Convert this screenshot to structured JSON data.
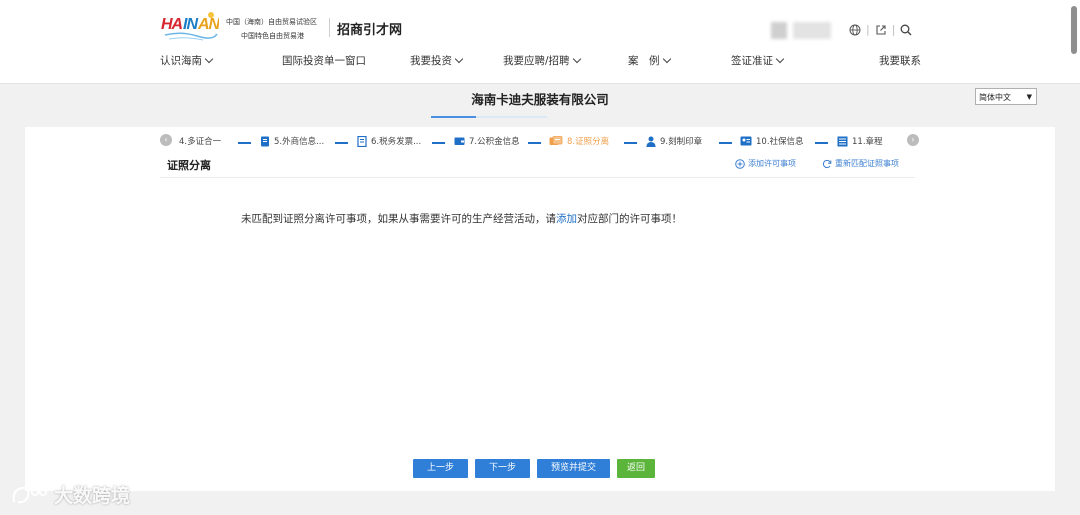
{
  "header": {
    "logo_text": "HAINAN",
    "logo_sub_line1": "中国（海南）自由贸易试验区",
    "logo_sub_line2": "中国特色自由贸易港",
    "site_name": "招商引才网",
    "icons": [
      "globe-icon",
      "external-link-icon",
      "search-icon"
    ]
  },
  "nav": {
    "items": [
      {
        "label": "认识海南",
        "dropdown": true
      },
      {
        "label": "国际投资单一窗口",
        "dropdown": false
      },
      {
        "label": "我要投资",
        "dropdown": true
      },
      {
        "label": "我要应聘/招聘",
        "dropdown": true
      },
      {
        "label": "案　例",
        "dropdown": true
      },
      {
        "label": "签证准证",
        "dropdown": true
      },
      {
        "label": "我要联系",
        "dropdown": false
      }
    ]
  },
  "page": {
    "company_title": "海南卡迪夫服装有限公司",
    "language": "简体中文"
  },
  "steps": [
    {
      "label": "4.多证合一",
      "icon": "",
      "active": false
    },
    {
      "label": "5.外商信息...",
      "icon": "document-icon",
      "active": false
    },
    {
      "label": "6.税务发票...",
      "icon": "invoice-icon",
      "active": false
    },
    {
      "label": "7.公积金信息",
      "icon": "wallet-icon",
      "active": false
    },
    {
      "label": "8.证照分离",
      "icon": "license-icon",
      "active": true
    },
    {
      "label": "9.刻制印章",
      "icon": "user-seal-icon",
      "active": false
    },
    {
      "label": "10.社保信息",
      "icon": "id-card-icon",
      "active": false
    },
    {
      "label": "11.章程",
      "icon": "grid-doc-icon",
      "active": false
    }
  ],
  "section": {
    "title": "证照分离",
    "add_permit": "添加许可事项",
    "rematch": "重新匹配证照事项"
  },
  "message": {
    "before": "未匹配到证照分离许可事项，如果从事需要许可的生产经营活动，请",
    "link": "添加",
    "after": "对应部门的许可事项！"
  },
  "buttons": {
    "prev": "上一步",
    "next": "下一步",
    "preview_submit": "预览并提交",
    "back": "返回"
  },
  "watermark": {
    "text": "大数跨境"
  },
  "colors": {
    "primary": "#2f7fd8",
    "success": "#5ab53a",
    "active_step": "#f0a04b",
    "link": "#1f6fc7"
  }
}
